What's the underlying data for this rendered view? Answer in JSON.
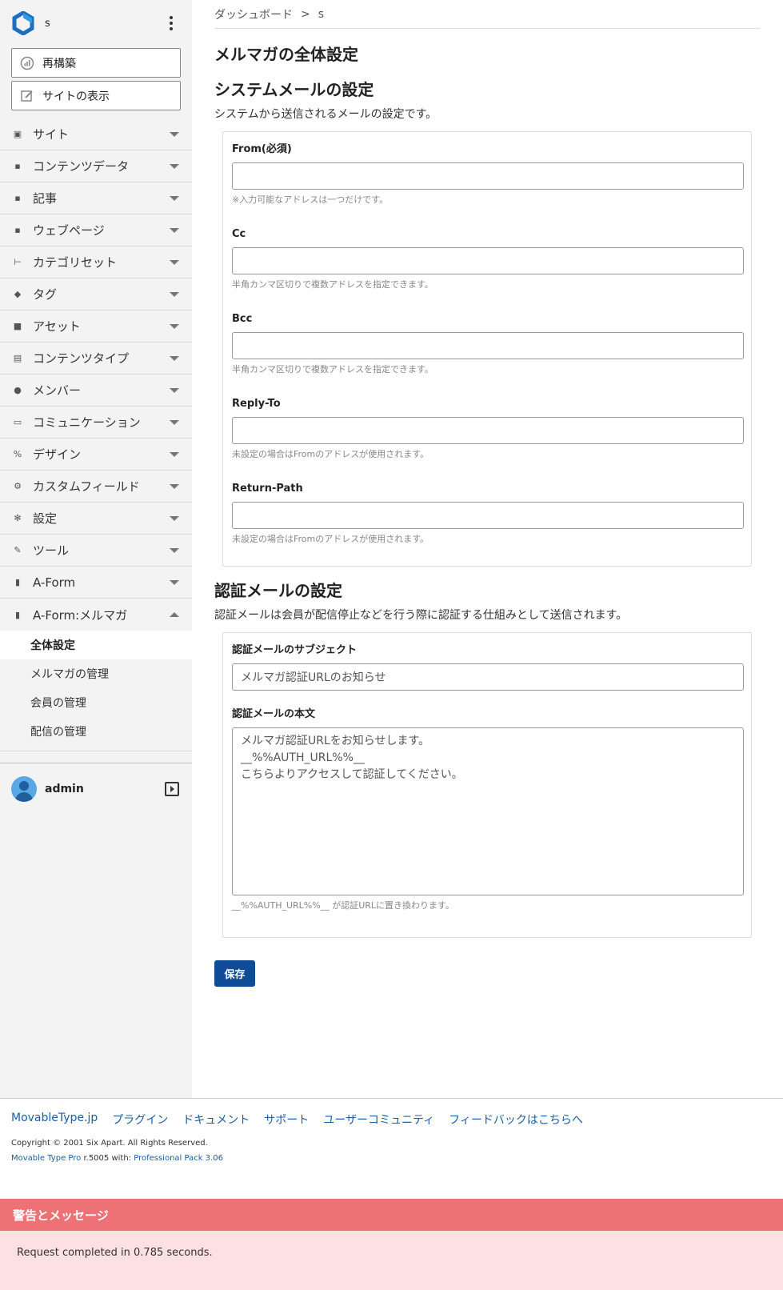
{
  "sidebar": {
    "site_name": "s",
    "rebuild_label": "再構築",
    "view_site_label": "サイトの表示",
    "menu": [
      {
        "label": "サイト",
        "icon": "sites-icon"
      },
      {
        "label": "コンテンツデータ",
        "icon": "content-data-icon"
      },
      {
        "label": "記事",
        "icon": "entry-icon"
      },
      {
        "label": "ウェブページ",
        "icon": "page-icon"
      },
      {
        "label": "カテゴリセット",
        "icon": "category-set-icon"
      },
      {
        "label": "タグ",
        "icon": "tag-icon"
      },
      {
        "label": "アセット",
        "icon": "asset-icon"
      },
      {
        "label": "コンテンツタイプ",
        "icon": "content-type-icon"
      },
      {
        "label": "メンバー",
        "icon": "member-icon"
      },
      {
        "label": "コミュニケーション",
        "icon": "communication-icon"
      },
      {
        "label": "デザイン",
        "icon": "design-icon"
      },
      {
        "label": "カスタムフィールド",
        "icon": "custom-field-icon"
      },
      {
        "label": "設定",
        "icon": "settings-icon"
      },
      {
        "label": "ツール",
        "icon": "tools-icon"
      },
      {
        "label": "A-Form",
        "icon": "aform-icon"
      },
      {
        "label": "A-Form:メルマガ",
        "icon": "aform-mailmag-icon"
      }
    ],
    "submenu": [
      {
        "label": "全体設定"
      },
      {
        "label": "メルマガの管理"
      },
      {
        "label": "会員の管理"
      },
      {
        "label": "配信の管理"
      }
    ],
    "user_name": "admin"
  },
  "breadcrumb": {
    "home": "ダッシュボード",
    "separator": ">",
    "current": "s"
  },
  "page_title": "メルマガの全体設定",
  "system_mail": {
    "title": "システムメールの設定",
    "description": "システムから送信されるメールの設定です。",
    "fields": [
      {
        "label": "From(必須)",
        "value": "",
        "hint": "※入力可能なアドレスは一つだけです。"
      },
      {
        "label": "Cc",
        "value": "",
        "hint": "半角カンマ区切りで複数アドレスを指定できます。"
      },
      {
        "label": "Bcc",
        "value": "",
        "hint": "半角カンマ区切りで複数アドレスを指定できます。"
      },
      {
        "label": "Reply-To",
        "value": "",
        "hint": "未設定の場合はFromのアドレスが使用されます。"
      },
      {
        "label": "Return-Path",
        "value": "",
        "hint": "未設定の場合はFromのアドレスが使用されます。"
      }
    ]
  },
  "auth_mail": {
    "title": "認証メールの設定",
    "description": "認証メールは会員が配信停止などを行う際に認証する仕組みとして送信されます。",
    "subject_label": "認証メールのサブジェクト",
    "subject_value": "メルマガ認証URLのお知らせ",
    "body_label": "認証メールの本文",
    "body_value": "メルマガ認証URLをお知らせします。\n__%%AUTH_URL%%__\nこちらよりアクセスして認証してください。",
    "body_hint": "__%%AUTH_URL%%__ が認証URLに置き換わります。"
  },
  "save_label": "保存",
  "footer": {
    "links": [
      "MovableType.jp",
      "プラグイン",
      "ドキュメント",
      "サポート",
      "ユーザーコミュニティ",
      "フィードバックはこちらへ"
    ],
    "copyright": "Copyright © 2001 Six Apart. All Rights Reserved.",
    "version_product": "Movable Type Pro",
    "version_text": " r.5005 with: ",
    "version_pack": "Professional Pack 3.06"
  },
  "messages": {
    "title": "警告とメッセージ",
    "body": "Request completed in 0.785 seconds."
  },
  "colors": {
    "accent": "#0e4c97",
    "link": "#1b5fa6",
    "alert_head": "#ee7275",
    "alert_body": "#fde0e1",
    "sidebar_bg": "#f3f3f3"
  }
}
